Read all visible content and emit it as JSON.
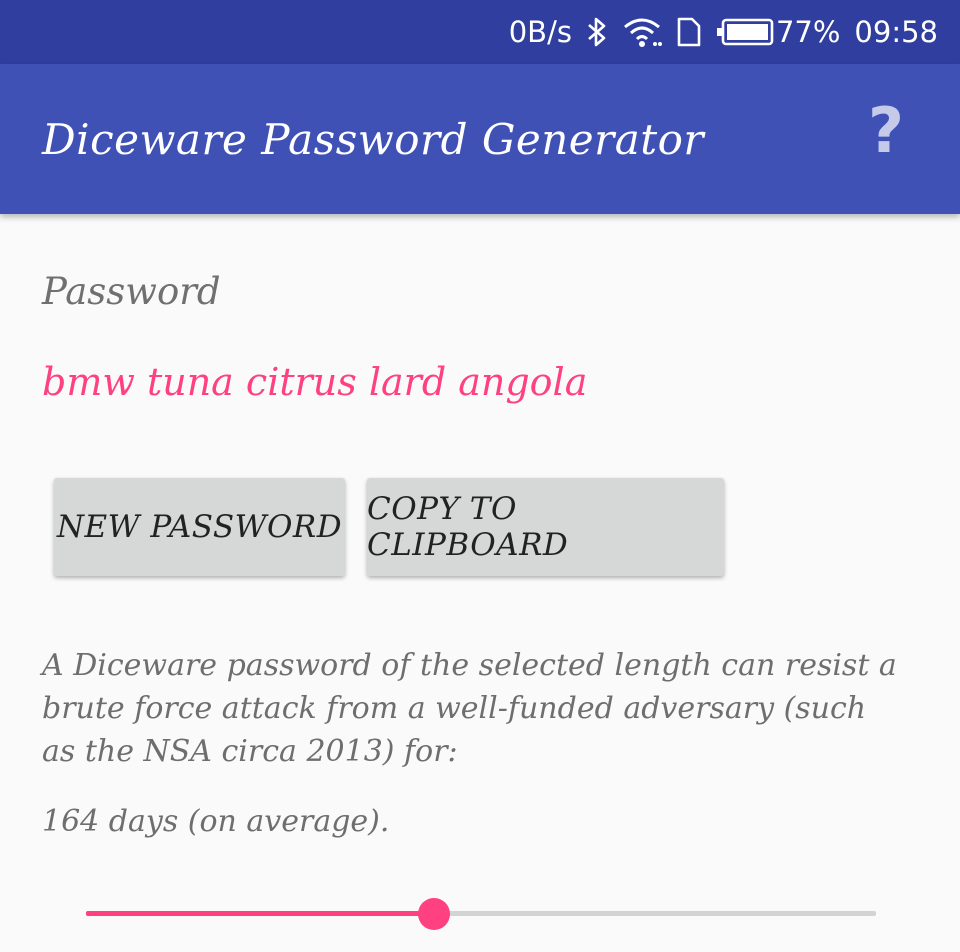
{
  "status_bar": {
    "network_speed": "0B/s",
    "battery_percent": "77%",
    "time": "09:58",
    "icons": [
      "bluetooth-icon",
      "wifi-icon",
      "sim-icon",
      "battery-icon"
    ]
  },
  "app_bar": {
    "title": "Diceware Password Generator",
    "help_label": "?"
  },
  "password": {
    "label": "Password",
    "value": "bmw tuna citrus lard angola"
  },
  "buttons": {
    "new_password": "NEW PASSWORD",
    "copy_to_clipboard": "COPY TO CLIPBOARD"
  },
  "info": {
    "description": "A Diceware password of the selected length can resist a brute force attack from a well-funded adversary (such as the NSA circa 2013) for:",
    "duration": "164 days (on average)."
  },
  "slider": {
    "fraction": 0.44
  },
  "colors": {
    "status_bar": "#303f9f",
    "app_bar": "#3f51b5",
    "accent": "#ff4081",
    "background": "#fafafa",
    "button": "#d6d7d7"
  }
}
